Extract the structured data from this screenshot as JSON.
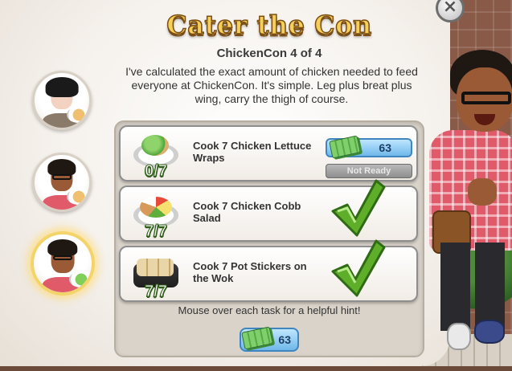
{
  "dialog": {
    "title": "Cater the Con",
    "subtitle": "ChickenCon 4 of 4",
    "description": "I've calculated the exact amount of chicken needed to feed everyone at ChickenCon. It's simple. Leg plus breat plus wing, carry the thigh of course.",
    "close_label": "×",
    "hint": "Mouse over each task for a helpful hint!",
    "total_reward": "63"
  },
  "tasks": [
    {
      "label": "Cook 7 Chicken Lettuce Wraps",
      "progress": "0/7",
      "reward": "63",
      "status": "Not Ready",
      "complete": false
    },
    {
      "label": "Cook 7 Chicken Cobb Salad",
      "progress": "7/7",
      "complete": true
    },
    {
      "label": "Cook 7 Pot Stickers on the Wok",
      "progress": "7/7",
      "complete": true
    }
  ],
  "quest_chain": [
    {
      "name": "quest-giver-1",
      "active": false
    },
    {
      "name": "quest-giver-2",
      "active": false
    },
    {
      "name": "quest-giver-3",
      "active": true
    }
  ],
  "icons": [
    "close-icon",
    "cash-icon",
    "checkmark-icon",
    "food-plate-icon"
  ],
  "colors": {
    "title_gold": "#f6cf5a",
    "reward_blue": "#6fb8ea",
    "check_green": "#5fae2a",
    "status_gray": "#8e8e8e"
  }
}
